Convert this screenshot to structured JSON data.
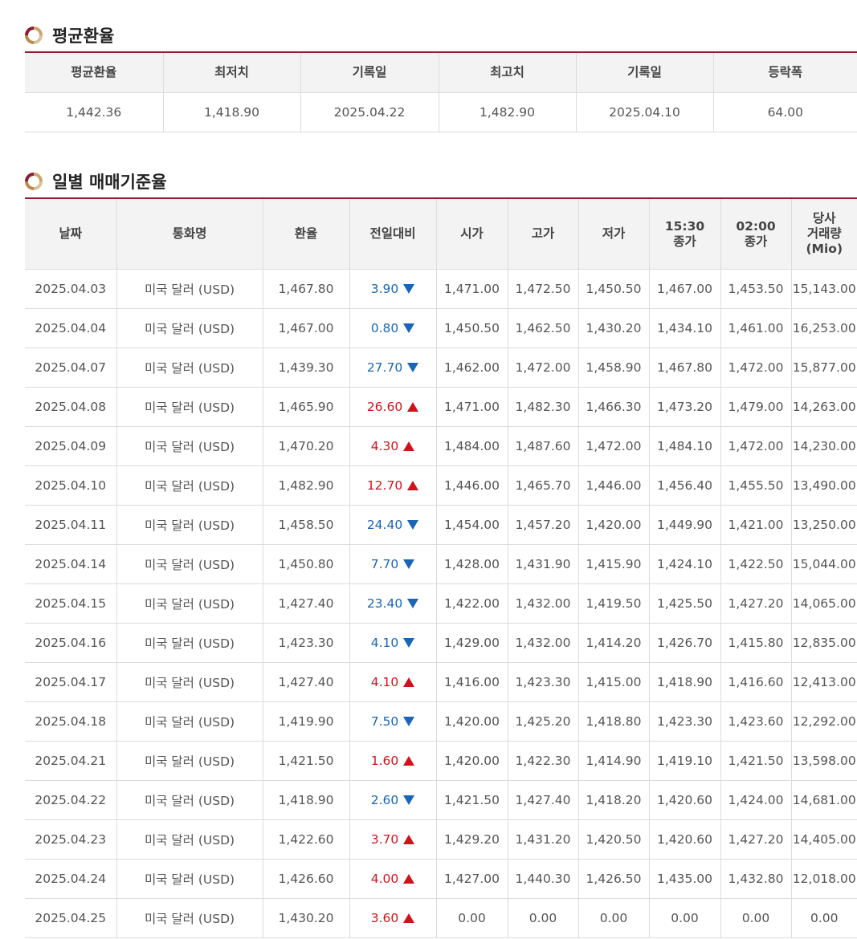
{
  "colors": {
    "accent": "#8b1c31",
    "down": "#1a65b6",
    "up": "#d0131b"
  },
  "average_section": {
    "title": "평균환율",
    "icon": "ring-icon",
    "headers": [
      "평균환율",
      "최저치",
      "기록일",
      "최고치",
      "기록일",
      "등락폭"
    ],
    "values": [
      "1,442.36",
      "1,418.90",
      "2025.04.22",
      "1,482.90",
      "2025.04.10",
      "64.00"
    ]
  },
  "daily_section": {
    "title": "일별 매매기준율",
    "icon": "ring-icon",
    "headers": [
      [
        "날짜"
      ],
      [
        "통화명"
      ],
      [
        "환율"
      ],
      [
        "전일대비"
      ],
      [
        "시가"
      ],
      [
        "고가"
      ],
      [
        "저가"
      ],
      [
        "15:30",
        "종가"
      ],
      [
        "02:00",
        "종가"
      ],
      [
        "당사",
        "거래량",
        "(Mio)"
      ]
    ],
    "rows": [
      {
        "date": "2025.04.03",
        "currency": "미국 달러 (USD)",
        "rate": "1,467.80",
        "change": "3.90",
        "dir": "down",
        "open": "1,471.00",
        "high": "1,472.50",
        "low": "1,450.50",
        "close1530": "1,467.00",
        "close0200": "1,453.50",
        "volume": "15,143.00"
      },
      {
        "date": "2025.04.04",
        "currency": "미국 달러 (USD)",
        "rate": "1,467.00",
        "change": "0.80",
        "dir": "down",
        "open": "1,450.50",
        "high": "1,462.50",
        "low": "1,430.20",
        "close1530": "1,434.10",
        "close0200": "1,461.00",
        "volume": "16,253.00"
      },
      {
        "date": "2025.04.07",
        "currency": "미국 달러 (USD)",
        "rate": "1,439.30",
        "change": "27.70",
        "dir": "down",
        "open": "1,462.00",
        "high": "1,472.00",
        "low": "1,458.90",
        "close1530": "1,467.80",
        "close0200": "1,472.00",
        "volume": "15,877.00"
      },
      {
        "date": "2025.04.08",
        "currency": "미국 달러 (USD)",
        "rate": "1,465.90",
        "change": "26.60",
        "dir": "up",
        "open": "1,471.00",
        "high": "1,482.30",
        "low": "1,466.30",
        "close1530": "1,473.20",
        "close0200": "1,479.00",
        "volume": "14,263.00"
      },
      {
        "date": "2025.04.09",
        "currency": "미국 달러 (USD)",
        "rate": "1,470.20",
        "change": "4.30",
        "dir": "up",
        "open": "1,484.00",
        "high": "1,487.60",
        "low": "1,472.00",
        "close1530": "1,484.10",
        "close0200": "1,472.00",
        "volume": "14,230.00"
      },
      {
        "date": "2025.04.10",
        "currency": "미국 달러 (USD)",
        "rate": "1,482.90",
        "change": "12.70",
        "dir": "up",
        "open": "1,446.00",
        "high": "1,465.70",
        "low": "1,446.00",
        "close1530": "1,456.40",
        "close0200": "1,455.50",
        "volume": "13,490.00"
      },
      {
        "date": "2025.04.11",
        "currency": "미국 달러 (USD)",
        "rate": "1,458.50",
        "change": "24.40",
        "dir": "down",
        "open": "1,454.00",
        "high": "1,457.20",
        "low": "1,420.00",
        "close1530": "1,449.90",
        "close0200": "1,421.00",
        "volume": "13,250.00"
      },
      {
        "date": "2025.04.14",
        "currency": "미국 달러 (USD)",
        "rate": "1,450.80",
        "change": "7.70",
        "dir": "down",
        "open": "1,428.00",
        "high": "1,431.90",
        "low": "1,415.90",
        "close1530": "1,424.10",
        "close0200": "1,422.50",
        "volume": "15,044.00"
      },
      {
        "date": "2025.04.15",
        "currency": "미국 달러 (USD)",
        "rate": "1,427.40",
        "change": "23.40",
        "dir": "down",
        "open": "1,422.00",
        "high": "1,432.00",
        "low": "1,419.50",
        "close1530": "1,425.50",
        "close0200": "1,427.20",
        "volume": "14,065.00"
      },
      {
        "date": "2025.04.16",
        "currency": "미국 달러 (USD)",
        "rate": "1,423.30",
        "change": "4.10",
        "dir": "down",
        "open": "1,429.00",
        "high": "1,432.00",
        "low": "1,414.20",
        "close1530": "1,426.70",
        "close0200": "1,415.80",
        "volume": "12,835.00"
      },
      {
        "date": "2025.04.17",
        "currency": "미국 달러 (USD)",
        "rate": "1,427.40",
        "change": "4.10",
        "dir": "up",
        "open": "1,416.00",
        "high": "1,423.30",
        "low": "1,415.00",
        "close1530": "1,418.90",
        "close0200": "1,416.60",
        "volume": "12,413.00"
      },
      {
        "date": "2025.04.18",
        "currency": "미국 달러 (USD)",
        "rate": "1,419.90",
        "change": "7.50",
        "dir": "down",
        "open": "1,420.00",
        "high": "1,425.20",
        "low": "1,418.80",
        "close1530": "1,423.30",
        "close0200": "1,423.60",
        "volume": "12,292.00"
      },
      {
        "date": "2025.04.21",
        "currency": "미국 달러 (USD)",
        "rate": "1,421.50",
        "change": "1.60",
        "dir": "up",
        "open": "1,420.00",
        "high": "1,422.30",
        "low": "1,414.90",
        "close1530": "1,419.10",
        "close0200": "1,421.50",
        "volume": "13,598.00"
      },
      {
        "date": "2025.04.22",
        "currency": "미국 달러 (USD)",
        "rate": "1,418.90",
        "change": "2.60",
        "dir": "down",
        "open": "1,421.50",
        "high": "1,427.40",
        "low": "1,418.20",
        "close1530": "1,420.60",
        "close0200": "1,424.00",
        "volume": "14,681.00"
      },
      {
        "date": "2025.04.23",
        "currency": "미국 달러 (USD)",
        "rate": "1,422.60",
        "change": "3.70",
        "dir": "up",
        "open": "1,429.20",
        "high": "1,431.20",
        "low": "1,420.50",
        "close1530": "1,420.60",
        "close0200": "1,427.20",
        "volume": "14,405.00"
      },
      {
        "date": "2025.04.24",
        "currency": "미국 달러 (USD)",
        "rate": "1,426.60",
        "change": "4.00",
        "dir": "up",
        "open": "1,427.00",
        "high": "1,440.30",
        "low": "1,426.50",
        "close1530": "1,435.00",
        "close0200": "1,432.80",
        "volume": "12,018.00"
      },
      {
        "date": "2025.04.25",
        "currency": "미국 달러 (USD)",
        "rate": "1,430.20",
        "change": "3.60",
        "dir": "up",
        "open": "0.00",
        "high": "0.00",
        "low": "0.00",
        "close1530": "0.00",
        "close0200": "0.00",
        "volume": "0.00"
      }
    ]
  }
}
